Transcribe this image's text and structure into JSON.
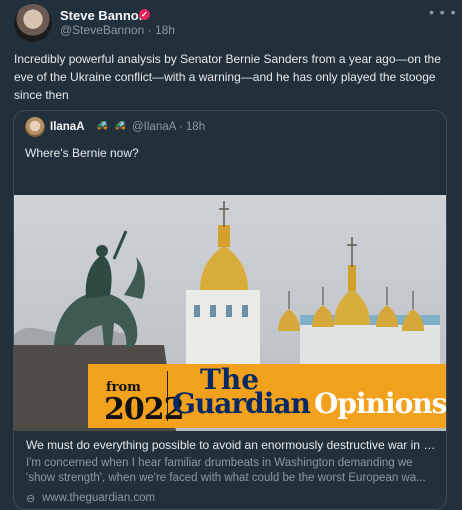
{
  "author": {
    "name": "Steve Bannon",
    "verified_badge": "✓",
    "handle": "@SteveBannon",
    "separator": "·",
    "time": "18h"
  },
  "post": {
    "text": "Incredibly powerful analysis by Senator Bernie Sanders from a year ago—on the eve of the Ukraine conflict—with a warning—and he has only played the stooge since then"
  },
  "quote": {
    "name": "IlanaA",
    "emoji_icons": [
      "tractor-icon",
      "tractor-icon"
    ],
    "handle": "@IlanaA",
    "separator": "·",
    "time": "18h",
    "text": "Where's Bernie now?"
  },
  "link_card": {
    "banner_from": "from",
    "banner_year": "2022",
    "banner_the": "The",
    "banner_guardian": "Guardian",
    "banner_opinions": "Opinions",
    "title": "We must do everything possible to avoid an enormously destructive war in U...",
    "description_line1": "I'm concerned when I hear familiar drumbeats in Washington demanding we",
    "description_line2": "'show strength', when we're faced with what could be the worst European wa...",
    "domain": "www.theguardian.com"
  },
  "icons": {
    "more": "more-horizontal-icon",
    "link": "link-icon",
    "tractor": "tractor-icon"
  },
  "colors": {
    "background": "#22303c",
    "accent_orange": "#f2a11d",
    "guardian_blue": "#052962",
    "verified": "#e0245e"
  }
}
